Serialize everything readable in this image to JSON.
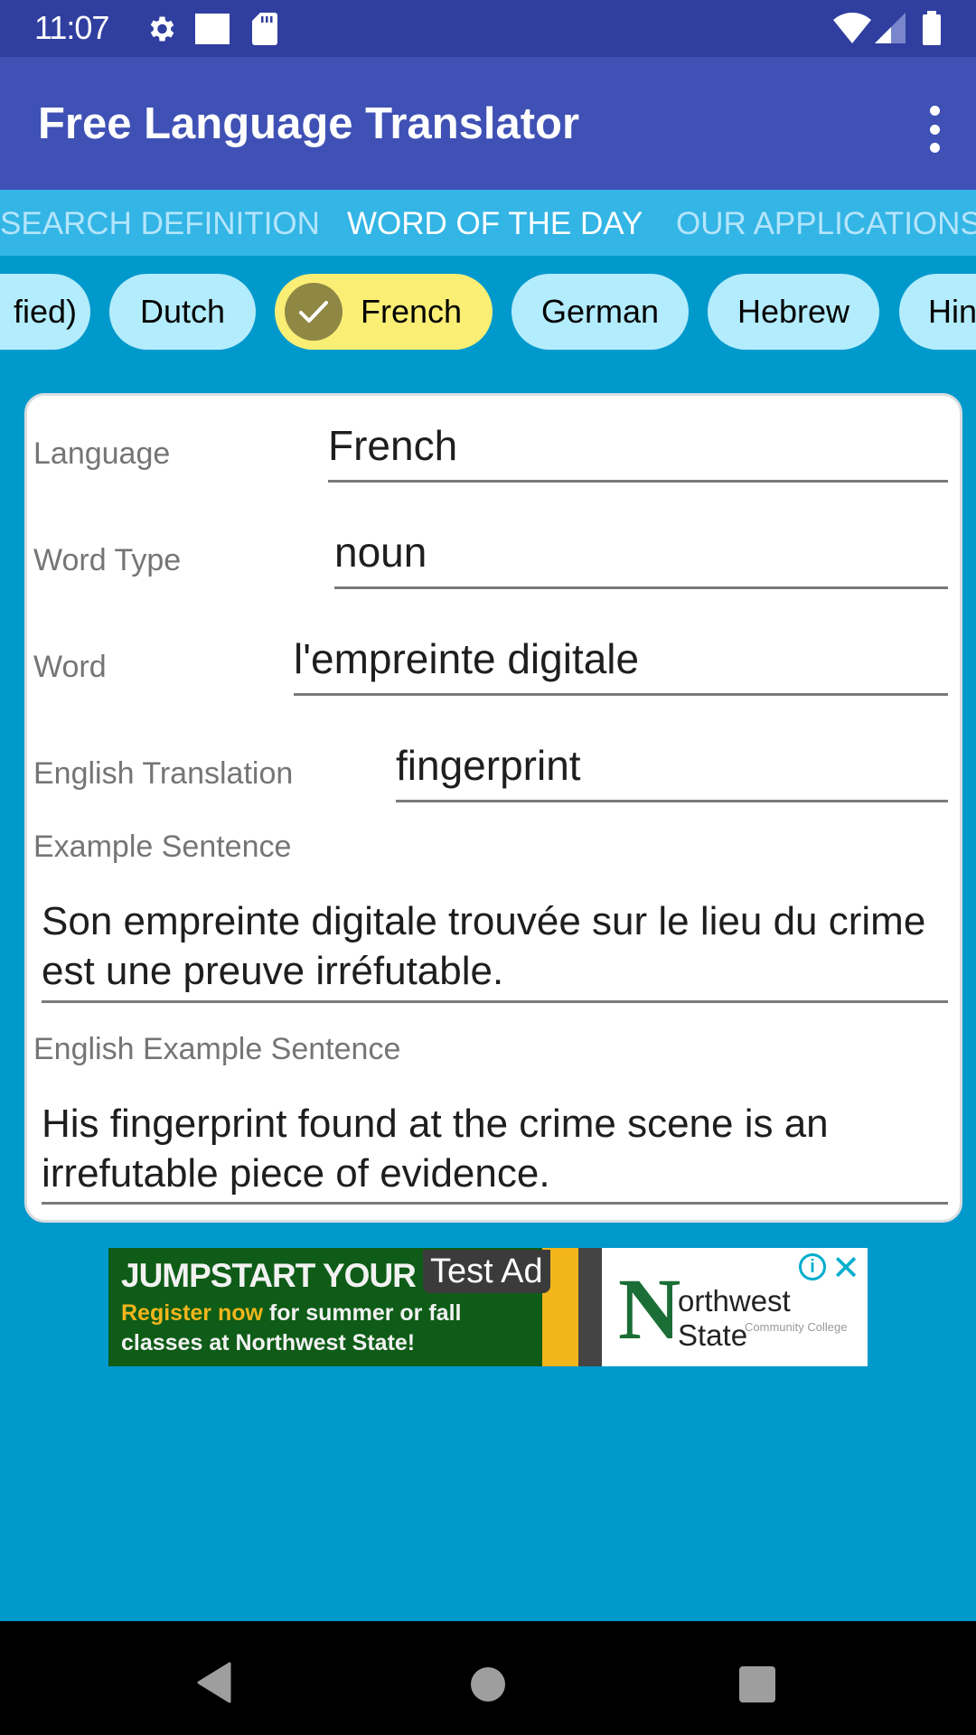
{
  "status_bar": {
    "time": "11:07",
    "left_icons": [
      "gear-icon",
      "square-notification-icon",
      "sd-card-icon"
    ],
    "right_icons": [
      "wifi-icon",
      "cell-signal-icon",
      "battery-icon"
    ]
  },
  "app_bar": {
    "title": "Free Language Translator",
    "overflow_icon": "more-vert-icon"
  },
  "tabs": [
    {
      "label": "SEARCH DEFINITION",
      "active": false
    },
    {
      "label": "WORD OF THE DAY",
      "active": true
    },
    {
      "label": "OUR APPLICATIONS",
      "active": false
    }
  ],
  "language_chips": [
    {
      "label": "(Simplified)",
      "visible_label": "fied)",
      "selected": false
    },
    {
      "label": "Dutch",
      "selected": false
    },
    {
      "label": "French",
      "selected": true
    },
    {
      "label": "German",
      "selected": false
    },
    {
      "label": "Hebrew",
      "selected": false
    },
    {
      "label": "Hin",
      "selected": false
    }
  ],
  "word_card": {
    "language": {
      "label": "Language",
      "value": "French"
    },
    "word_type": {
      "label": "Word Type",
      "value": "noun"
    },
    "word": {
      "label": "Word",
      "value": "l'empreinte digitale"
    },
    "english_translation": {
      "label": "English Translation",
      "value": "fingerprint"
    },
    "example_sentence": {
      "label": "Example Sentence",
      "value": "Son empreinte digitale trouvée sur le lieu du crime est une preuve irréfutable."
    },
    "english_example_sentence": {
      "label": "English Example Sentence",
      "value": "His fingerprint found at the crime scene is an irrefutable piece of evidence."
    }
  },
  "ad": {
    "badge": "Test Ad",
    "headline": "JUMPSTART YOUR F",
    "body_highlight": "Register now",
    "body_line1_rest": " for summer or fall",
    "body_line2": "classes at Northwest State!",
    "logo_letter": "N",
    "logo_text": "orthwest State",
    "logo_subtext": "Community College",
    "info_label": "i",
    "close_label": "✕"
  },
  "nav_bar": {
    "back": "back-icon",
    "home": "home-icon",
    "recents": "recents-icon"
  },
  "colors": {
    "status_bar": "#303f9f",
    "app_bar": "#3f51b5",
    "tab_bar": "#33b5e5",
    "background": "#0099cc",
    "chip": "#b3ecfc",
    "chip_selected": "#fbee75",
    "ad_accent": "#00aecd"
  }
}
